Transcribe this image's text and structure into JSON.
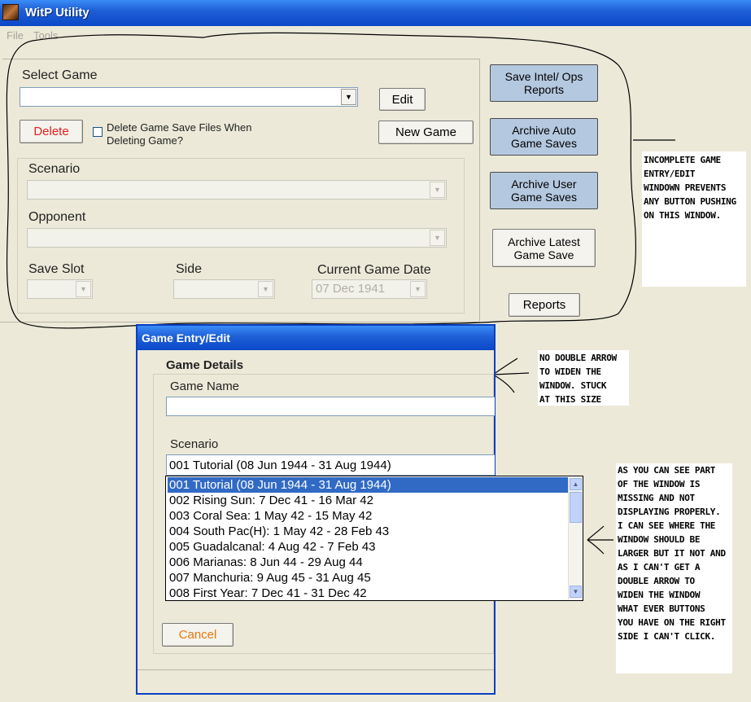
{
  "window": {
    "title": "WitP Utility",
    "menu": [
      "File",
      "Tools"
    ]
  },
  "main": {
    "select_game_label": "Select Game",
    "edit_button": "Edit",
    "delete_button": "Delete",
    "delete_checkbox_label_1": "Delete Game Save Files When",
    "delete_checkbox_label_2": "Deleting Game?",
    "new_game_button": "New Game",
    "scenario_label": "Scenario",
    "opponent_label": "Opponent",
    "save_slot_label": "Save Slot",
    "side_label": "Side",
    "current_date_label": "Current Game Date",
    "current_date_value": "07 Dec 1941",
    "colors": {
      "delete_text": "#e0201a",
      "side_button_bg": "#b4c8e0"
    }
  },
  "side_buttons": {
    "save_intel_1": "Save Intel/ Ops",
    "save_intel_2": "Reports",
    "archive_auto_1": "Archive Auto",
    "archive_auto_2": "Game Saves",
    "archive_user_1": "Archive User",
    "archive_user_2": "Game Saves",
    "archive_latest_1": "Archive Latest",
    "archive_latest_2": "Game Save",
    "reports": "Reports"
  },
  "notes": {
    "note1": [
      "INCOMPLETE GAME",
      "ENTRY/EDIT",
      "WINDOWN PREVENTS",
      "ANY BUTTON PUSHING",
      "ON THIS WINDOW."
    ],
    "note2": [
      "NO DOUBLE ARROW",
      "TO WIDEN THE",
      "WINDOW.  STUCK",
      "AT THIS SIZE"
    ],
    "note3": [
      "AS YOU CAN SEE PART",
      "OF THE WINDOW IS",
      "MISSING AND NOT",
      "DISPLAYING PROPERLY.",
      "I CAN SEE WHERE THE",
      "WINDOW SHOULD BE",
      "LARGER BUT IT NOT AND",
      "AS I CAN'T GET A",
      "DOUBLE ARROW TO",
      "WIDEN THE WINDOW",
      "WHAT EVER BUTTONS",
      "YOU HAVE ON THE RIGHT",
      "SIDE I CAN'T CLICK."
    ]
  },
  "dialog": {
    "title": "Game Entry/Edit",
    "group_label": "Game Details",
    "game_name_label": "Game Name",
    "game_name_value": "",
    "scenario_label": "Scenario",
    "scenario_value": "001 Tutorial (08 Jun 1944 - 31 Aug 1944)",
    "scenario_options": [
      "001 Tutorial (08 Jun 1944 - 31 Aug 1944)",
      "002 Rising Sun: 7 Dec 41 - 16 Mar 42",
      "003 Coral Sea: 1 May 42 - 15 May 42",
      "004 South Pac(H): 1 May 42 - 28 Feb 43",
      "005 Guadalcanal: 4 Aug 42 - 7 Feb 43",
      "006 Marianas: 8 Jun 44 - 29 Aug 44",
      "007 Manchuria: 9 Aug 45 - 31 Aug 45",
      "008 First Year: 7 Dec 41 - 31 Dec 42"
    ],
    "cancel_button": "Cancel",
    "colors": {
      "cancel_text": "#e8780a",
      "selected_bg": "#316ac5"
    }
  }
}
